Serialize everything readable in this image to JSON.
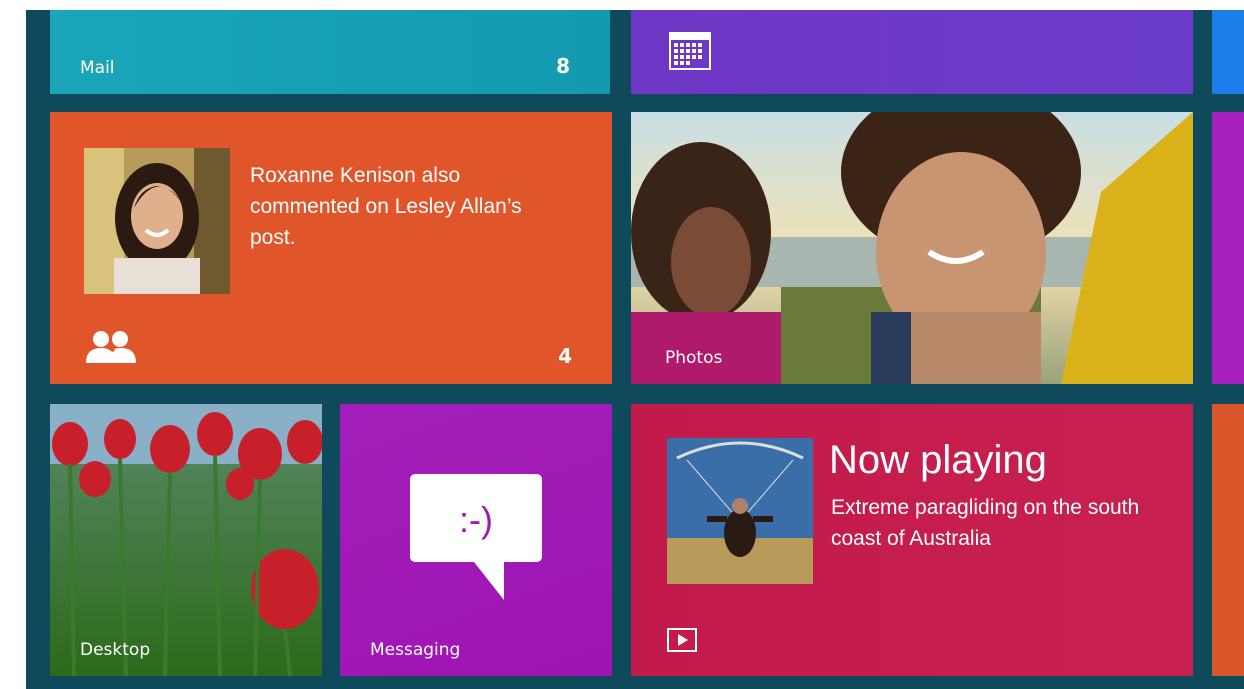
{
  "tiles": {
    "mail": {
      "label": "Mail",
      "count": "8"
    },
    "calendar": {
      "icon": "calendar-icon"
    },
    "people": {
      "text": "Roxanne Kenison also commented on Lesley Allan’s post.",
      "count": "4",
      "icon": "people-icon"
    },
    "photos": {
      "label": "Photos"
    },
    "desktop": {
      "label": "Desktop"
    },
    "messaging": {
      "label": "Messaging",
      "emoticon": ":-)",
      "icon": "speech-bubble-icon"
    },
    "video": {
      "title": "Now playing",
      "subtitle": "Extreme paragliding on the south coast of Australia",
      "icon": "play-icon"
    }
  },
  "colors": {
    "background": "#0e4a5c",
    "mail": "#17a0b5",
    "calendar": "#6c3ac7",
    "people": "#e0562a",
    "messaging": "#a11ab6",
    "video": "#c41d4c",
    "blue_partial": "#1b7de8",
    "purple_partial": "#a71fbd",
    "orange_partial": "#d9552a"
  }
}
